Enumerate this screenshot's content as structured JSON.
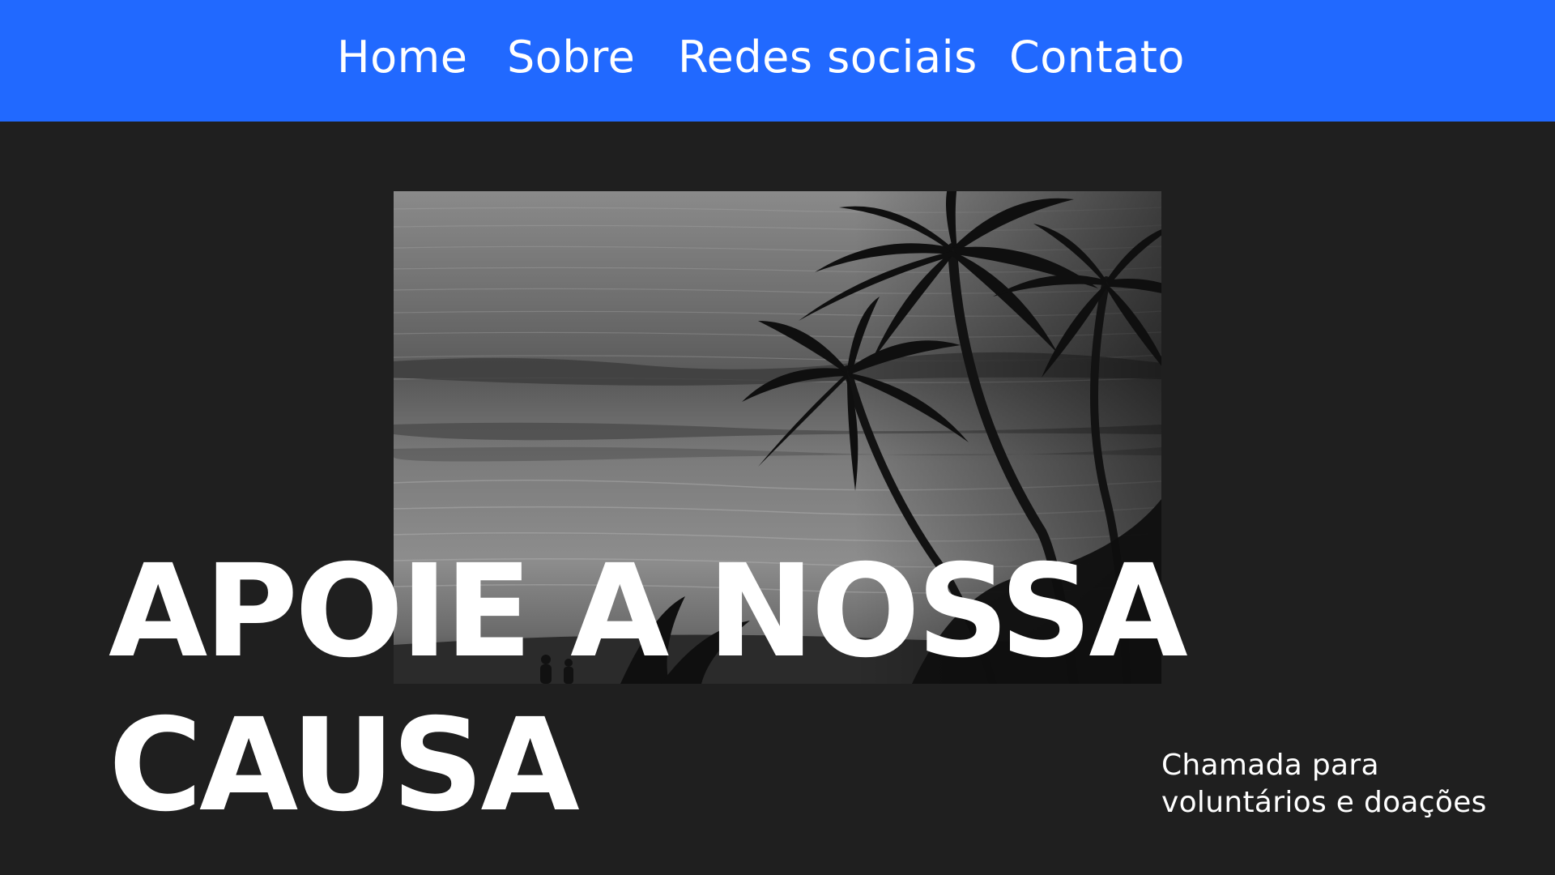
{
  "nav": {
    "home": "Home",
    "sobre": "Sobre",
    "redes": "Redes sociais",
    "contato": "Contato"
  },
  "hero": {
    "title_line1": "APOIE A NOSSA",
    "title_line2": "CAUSA",
    "subtitle_line1": "Chamada para",
    "subtitle_line2": "voluntários e doações"
  },
  "colors": {
    "nav_background": "#2169ff",
    "page_background": "#1f1f1f",
    "text": "#ffffff"
  },
  "icons": {
    "hero_image": "beach-palm-trees-photo"
  }
}
